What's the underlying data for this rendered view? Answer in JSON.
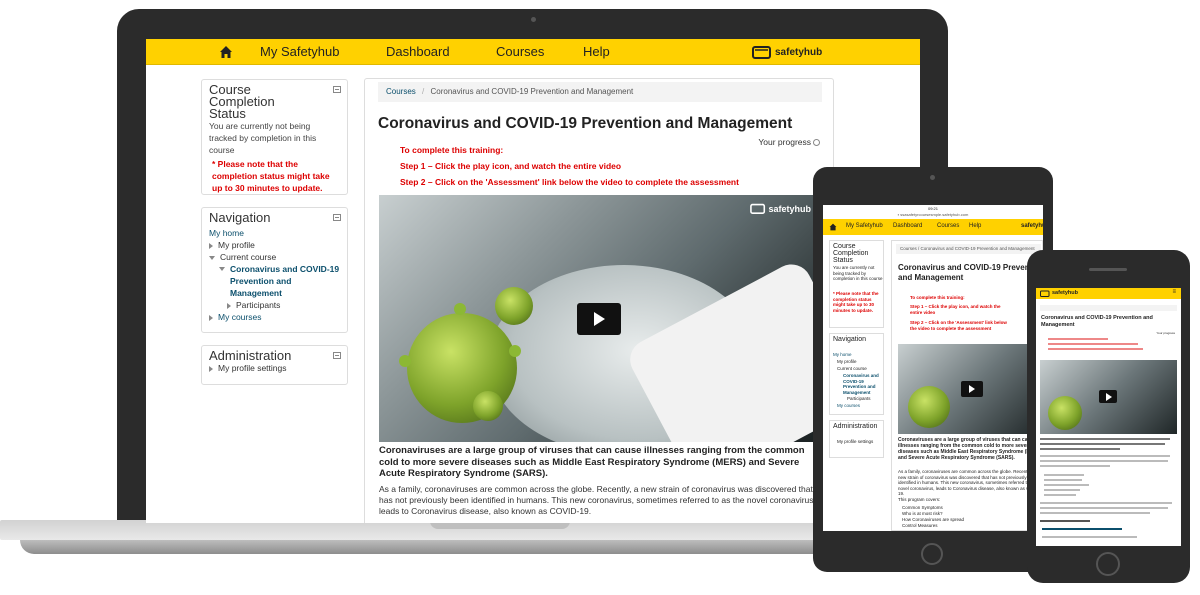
{
  "nav": {
    "items": [
      "My Safetyhub",
      "Dashboard",
      "Courses",
      "Help"
    ],
    "brand": "safetyhub"
  },
  "completion": {
    "title": "Course Completion Status",
    "tracking": "You are currently not being tracked by completion in this course",
    "note": "* Please note that the completion status might take up to 30 minutes to update."
  },
  "navigation_block": {
    "title": "Navigation",
    "my_home": "My home",
    "my_profile": "My profile",
    "current_course": "Current course",
    "course_name": "Coronavirus and COVID-19 Prevention and Management",
    "participants": "Participants",
    "my_courses": "My courses"
  },
  "administration": {
    "title": "Administration",
    "profile_settings": "My profile settings"
  },
  "breadcrumb": {
    "courses": "Courses",
    "separator": "/",
    "current": "Coronavirus and COVID-19 Prevention and Management"
  },
  "page": {
    "title": "Coronavirus and COVID-19 Prevention and Management",
    "progress_label": "Your progress",
    "instr_heading": "To complete this training:",
    "step1": "Step 1 – Click the play icon, and watch the entire video",
    "step2": "Step 2 – Click on the 'Assessment' link below the video to complete the assessment",
    "video_logo": "safetyhub",
    "intro_bold": "Coronaviruses are a large group of viruses that can cause illnesses ranging from the common cold to more severe diseases such as Middle East Respiratory Syndrome (MERS) and Severe Acute Respiratory Syndrome (SARS).",
    "intro": "As a family, coronaviruses are common across the globe. Recently, a new strain of coronavirus was discovered that has not previously been identified in humans. This new coronavirus, sometimes referred to as the novel coronavirus, leads to Coronavirus disease, also known as COVID-19."
  },
  "tablet": {
    "status_time": "09:21",
    "url": "▪ ssasafetyrcoursesmple.safetyhub.com",
    "nav": [
      "My Safetyhub",
      "Dashboard",
      "Courses",
      "Help"
    ],
    "completion_title": "Course Completion Status",
    "completion_text": "You are currently not being tracked by completion in this course",
    "completion_note": "* Please note that the completion status might take up to 30 minutes to update.",
    "navigation_title": "Navigation",
    "nav_items": [
      "My home",
      "My profile",
      "Current course",
      "Coronavirus and COVID-19 Prevention and Management",
      "Participants",
      "My courses"
    ],
    "admin_title": "Administration",
    "admin_item": "My profile settings",
    "breadcrumb": "Courses / Coronavirus and COVID-19 Prevention and Management",
    "title": "Coronavirus and COVID-19 Prevention and Management",
    "instr_heading": "To complete this training:",
    "step1": "Step 1 – Click the play icon, and watch the entire video",
    "step2": "Step 2 – Click on the 'Assessment' link below the video to complete the assessment",
    "intro_bold": "Coronaviruses are a large group of viruses that can cause illnesses ranging from the common cold to more severe diseases such as Middle East Respiratory Syndrome (MERS) and Severe Acute Respiratory Syndrome (SARS).",
    "intro": "As a family, coronaviruses are common across the globe. Recently, a new strain of coronavirus was discovered that has not previously been identified in humans. This new coronavirus, sometimes referred to as the novel coronavirus, leads to Coronavirus disease, also known as COVID-19.",
    "covers": "This program covers:",
    "cover_items": [
      "Common Symptoms",
      "Who is at most risk?",
      "How Coronaviruses are spread",
      "Control Measures",
      "Hand Washing"
    ]
  },
  "phone": {
    "title": "Coronavirus and COVID-19 Prevention and Management",
    "progress_label": "Your progress"
  }
}
